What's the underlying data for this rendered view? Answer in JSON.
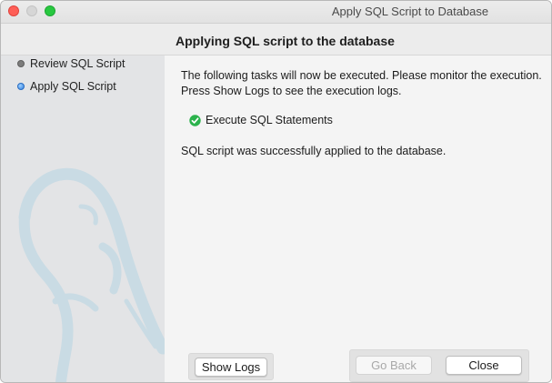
{
  "window": {
    "title": "Apply SQL Script to Database"
  },
  "header": {
    "title": "Applying SQL script to the database"
  },
  "sidebar": {
    "items": [
      {
        "label": "Review SQL Script",
        "state": "done"
      },
      {
        "label": "Apply SQL Script",
        "state": "active"
      }
    ]
  },
  "content": {
    "intro_line1": "The following tasks will now be executed. Please monitor the execution.",
    "intro_line2": "Press Show Logs to see the execution logs.",
    "task": {
      "label": "Execute SQL Statements",
      "status": "success",
      "icon": "check-circle-icon"
    },
    "result": "SQL script was successfully applied to the database."
  },
  "buttons": {
    "show_logs": "Show Logs",
    "go_back": "Go Back",
    "close": "Close"
  },
  "colors": {
    "close": "#fe5f57",
    "minimize": "#d6d6d6",
    "zoom": "#28c840",
    "success": "#2bb24c",
    "active_step": "#2f7fe0"
  }
}
